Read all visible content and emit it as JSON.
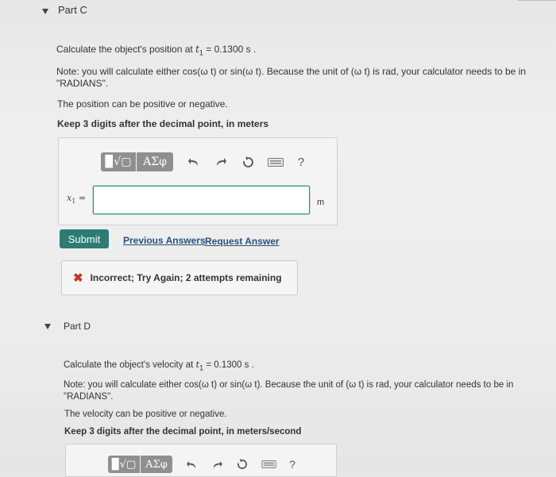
{
  "part_c": {
    "title": "Part C",
    "question_prefix": "Calculate the object's position at ",
    "time_symbol": "t",
    "time_sub": "1",
    "time_value": " = 0.1300 s .",
    "note_line1": "Note: you will calculate either cos(ω t) or sin(ω t). Because the unit of (ω t) is rad, your calculator needs to be in",
    "note_line2": "\"RADIANS\".",
    "sign_note": "The position can be positive or negative.",
    "precision_note": "Keep 3 digits after the decimal point, in meters",
    "answer_label_var": "x",
    "answer_label_sub": "1",
    "answer_label_eq": "=",
    "answer_value": "",
    "unit": "m",
    "submit_label": "Submit",
    "previous_answers_label": "Previous Answers",
    "request_answer_label": "Request Answer",
    "feedback_text": "Incorrect; Try Again; 2 attempts remaining"
  },
  "toolbar": {
    "template_button": "▉√▢",
    "greek_button": "ΑΣφ",
    "help_label": "?"
  },
  "part_d": {
    "title": "Part D",
    "question_prefix": "Calculate the object's velocity at ",
    "time_symbol": "t",
    "time_sub": "1",
    "time_value": " = 0.1300 s .",
    "note_line1": "Note: you will calculate either cos(ω t) or sin(ω t). Because the unit of (ω t) is rad, your calculator needs to be in",
    "note_line2": "\"RADIANS\".",
    "sign_note": "The velocity can be positive or negative.",
    "precision_note": "Keep 3 digits after the decimal point, in meters/second"
  },
  "colors": {
    "submit": "#2c7c74",
    "input_border": "#2f8a89",
    "error_x": "#c0392b",
    "link": "#2a4f7a"
  }
}
